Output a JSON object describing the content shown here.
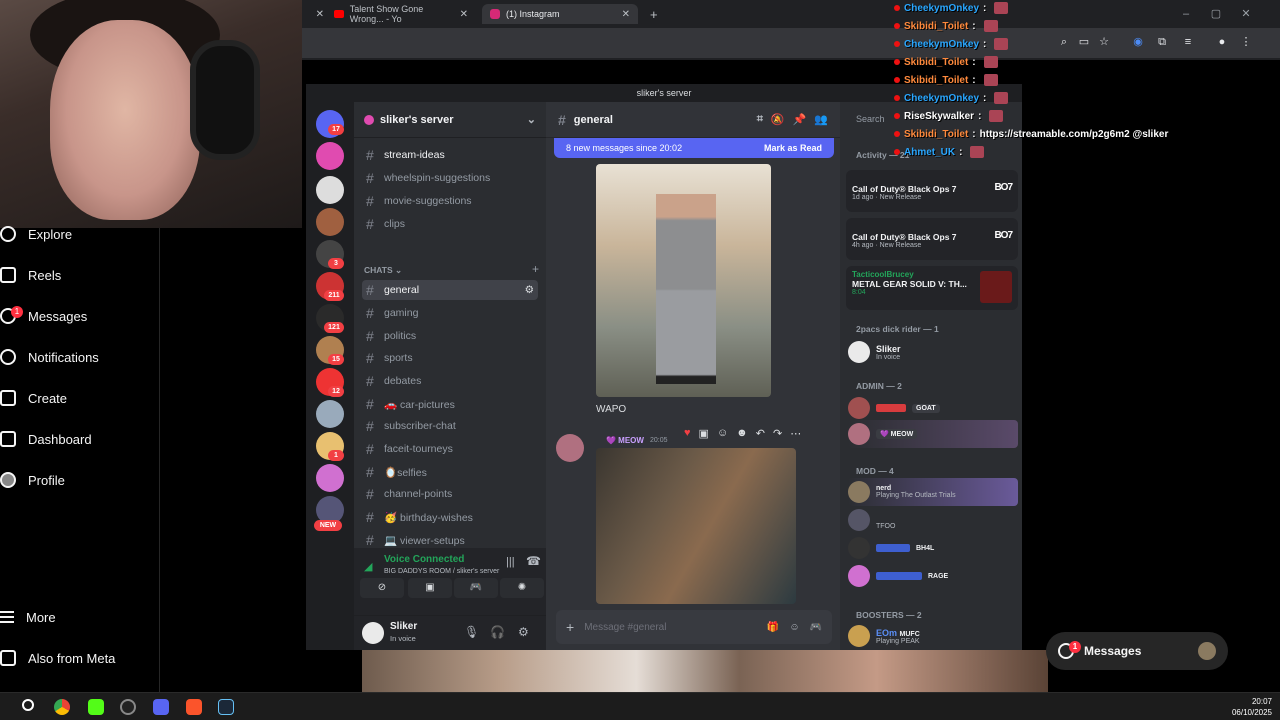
{
  "webcam": {
    "label": "streamer-webcam"
  },
  "instagram_nav": {
    "items": [
      {
        "label": "Explore"
      },
      {
        "label": "Reels"
      },
      {
        "label": "Messages",
        "badge": "1"
      },
      {
        "label": "Notifications"
      },
      {
        "label": "Create"
      },
      {
        "label": "Dashboard"
      },
      {
        "label": "Profile"
      },
      {
        "label": "More"
      },
      {
        "label": "Also from Meta"
      }
    ],
    "messages_pill": {
      "label": "Messages",
      "badge": "1"
    }
  },
  "browser": {
    "tabs": [
      {
        "title": "Talent Show Gone Wrong... - Yo"
      },
      {
        "title": "(1) Instagram"
      }
    ],
    "new_tab": "+"
  },
  "discord": {
    "window_title": "sliker's server",
    "server_name": "sliker's server",
    "guild_badges": [
      "17",
      "3",
      "211",
      "121",
      "15",
      "12",
      "1",
      "NEW"
    ],
    "channels_top": [
      "stream-ideas",
      "wheelspin-suggestions",
      "movie-suggestions",
      "clips"
    ],
    "category": "CHATS",
    "channels_chats": [
      "general",
      "gaming",
      "politics",
      "sports",
      "debates",
      "🚗 car-pictures",
      "subscriber-chat",
      "faceit-tourneys",
      "🪞selfies",
      "channel-points",
      "🥳 birthday-wishes",
      "💻 viewer-setups"
    ],
    "voice": {
      "status": "Voice Connected",
      "room": "BIG DADDYS ROOM / sliker's server"
    },
    "user": {
      "name": "Sliker",
      "status": "In voice"
    },
    "chat": {
      "channel": "general",
      "new_messages": "8 new messages since 20:02",
      "mark_read": "Mark as Read",
      "caption1": "WAPO",
      "msg2_author": "💜 MEOW",
      "msg2_time": "20:05",
      "input_placeholder": "Message #general"
    },
    "members": {
      "search": "Search",
      "activity_header": "Activity — 21",
      "activities": [
        {
          "game": "Call of Duty® Black Ops 7",
          "meta": "1d ago · New Release",
          "logo": "BO7"
        },
        {
          "game": "Call of Duty® Black Ops 7",
          "meta": "4h ago · New Release",
          "logo": "BO7"
        },
        {
          "user": "TacticoolBrucey",
          "game": "METAL GEAR SOLID V: TH...",
          "meta": "8:04"
        }
      ],
      "group1": "2pacs dick rider — 1",
      "group1_member": {
        "name": "Sliker",
        "status": "In voice"
      },
      "admin_header": "ADMIN — 2",
      "admin_tags": [
        "GOAT",
        "💜 MEOW"
      ],
      "mod_header": "MOD — 4",
      "mod_members": [
        {
          "tag": "nerd",
          "status": "Playing The Outlast Trials"
        },
        {
          "tag": "",
          "status": "TFOO"
        },
        {
          "tag": "BH4L",
          "status": ""
        },
        {
          "tag": "RAGE",
          "status": ""
        }
      ],
      "boosters_header": "BOOSTERS — 2",
      "booster": {
        "name": "EOm",
        "tag": "MUFC",
        "status": "Playing PEAK"
      }
    }
  },
  "chat_overlay": [
    {
      "user": "CheekymOnkey",
      "text": "",
      "color": "#2aa7ff"
    },
    {
      "user": "Skibidi_Toilet",
      "text": "",
      "color": "#ff8a3d"
    },
    {
      "user": "CheekymOnkey",
      "text": "",
      "color": "#2aa7ff"
    },
    {
      "user": "Skibidi_Toilet",
      "text": "",
      "color": "#ff8a3d"
    },
    {
      "user": "Skibidi_Toilet",
      "text": "",
      "color": "#ff8a3d"
    },
    {
      "user": "CheekymOnkey",
      "text": "",
      "color": "#2aa7ff"
    },
    {
      "user": "RiseSkywalker",
      "text": "",
      "color": "#ffffff"
    },
    {
      "user": "Skibidi_Toilet",
      "text": "https://streamable.com/p2g6m2 @sliker",
      "color": "#ff8a3d"
    },
    {
      "user": "Ahmet_UK",
      "text": "",
      "color": "#2aa7ff"
    }
  ],
  "taskbar": {
    "time": "20:07",
    "date": "06/10/2025"
  },
  "colors": {
    "discord_bg": "#313338",
    "blurple": "#5865f2",
    "ig_red": "#ff3040"
  }
}
